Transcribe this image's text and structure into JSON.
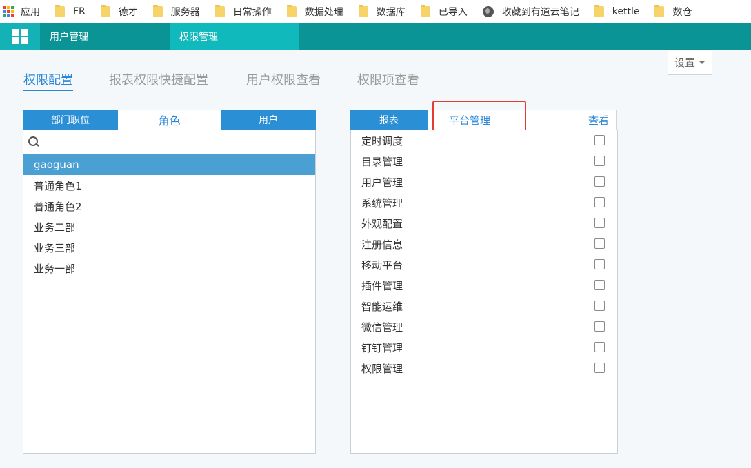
{
  "bookmarks": [
    {
      "label": "应用",
      "icon": "apps-grid-icon"
    },
    {
      "label": "FR",
      "icon": "folder-icon"
    },
    {
      "label": "德才",
      "icon": "folder-icon"
    },
    {
      "label": "服务器",
      "icon": "folder-icon"
    },
    {
      "label": "日常操作",
      "icon": "folder-icon"
    },
    {
      "label": "数据处理",
      "icon": "folder-icon"
    },
    {
      "label": "数据库",
      "icon": "folder-icon"
    },
    {
      "label": "已导入",
      "icon": "folder-icon"
    },
    {
      "label": "收藏到有道云笔记",
      "icon": "globe-icon"
    },
    {
      "label": "kettle",
      "icon": "folder-icon"
    },
    {
      "label": "数仓",
      "icon": "folder-icon"
    }
  ],
  "topbar": {
    "tabs": [
      {
        "label": "用户管理"
      },
      {
        "label": "权限管理"
      }
    ],
    "logo_icon": "windows-grid-icon",
    "color": "#0a9496",
    "active_color": "#10b9bc"
  },
  "settings": {
    "label": "设置",
    "icon": "caret-down-icon"
  },
  "section_tabs": [
    {
      "label": "权限配置",
      "active": true
    },
    {
      "label": "报表权限快捷配置",
      "active": false
    },
    {
      "label": "用户权限查看",
      "active": false
    },
    {
      "label": "权限项查看",
      "active": false
    }
  ],
  "left": {
    "tabs": [
      {
        "label": "部门职位"
      },
      {
        "label": "角色"
      },
      {
        "label": "用户"
      }
    ],
    "search": {
      "placeholder": "",
      "value": "",
      "icon": "search-icon"
    },
    "roles": [
      {
        "label": "gaoguan",
        "selected": true
      },
      {
        "label": "普通角色1",
        "selected": false
      },
      {
        "label": "普通角色2",
        "selected": false
      },
      {
        "label": "业务二部",
        "selected": false
      },
      {
        "label": "业务三部",
        "selected": false
      },
      {
        "label": "业务一部",
        "selected": false
      }
    ]
  },
  "right": {
    "tabs": {
      "report": "报表",
      "platform": "平台管理",
      "view": "查看"
    },
    "items": [
      {
        "label": "定时调度",
        "checked": false
      },
      {
        "label": "目录管理",
        "checked": false
      },
      {
        "label": "用户管理",
        "checked": false
      },
      {
        "label": "系统管理",
        "checked": false
      },
      {
        "label": "外观配置",
        "checked": false
      },
      {
        "label": "注册信息",
        "checked": false
      },
      {
        "label": "移动平台",
        "checked": false
      },
      {
        "label": "插件管理",
        "checked": false
      },
      {
        "label": "智能运维",
        "checked": false
      },
      {
        "label": "微信管理",
        "checked": false
      },
      {
        "label": "钉钉管理",
        "checked": false
      },
      {
        "label": "权限管理",
        "checked": false
      }
    ]
  },
  "colors": {
    "accent": "#2b88d8",
    "tab_blue": "#2b8fd6",
    "selected_row": "#4aa0d3",
    "highlight_red": "#e63b32"
  }
}
